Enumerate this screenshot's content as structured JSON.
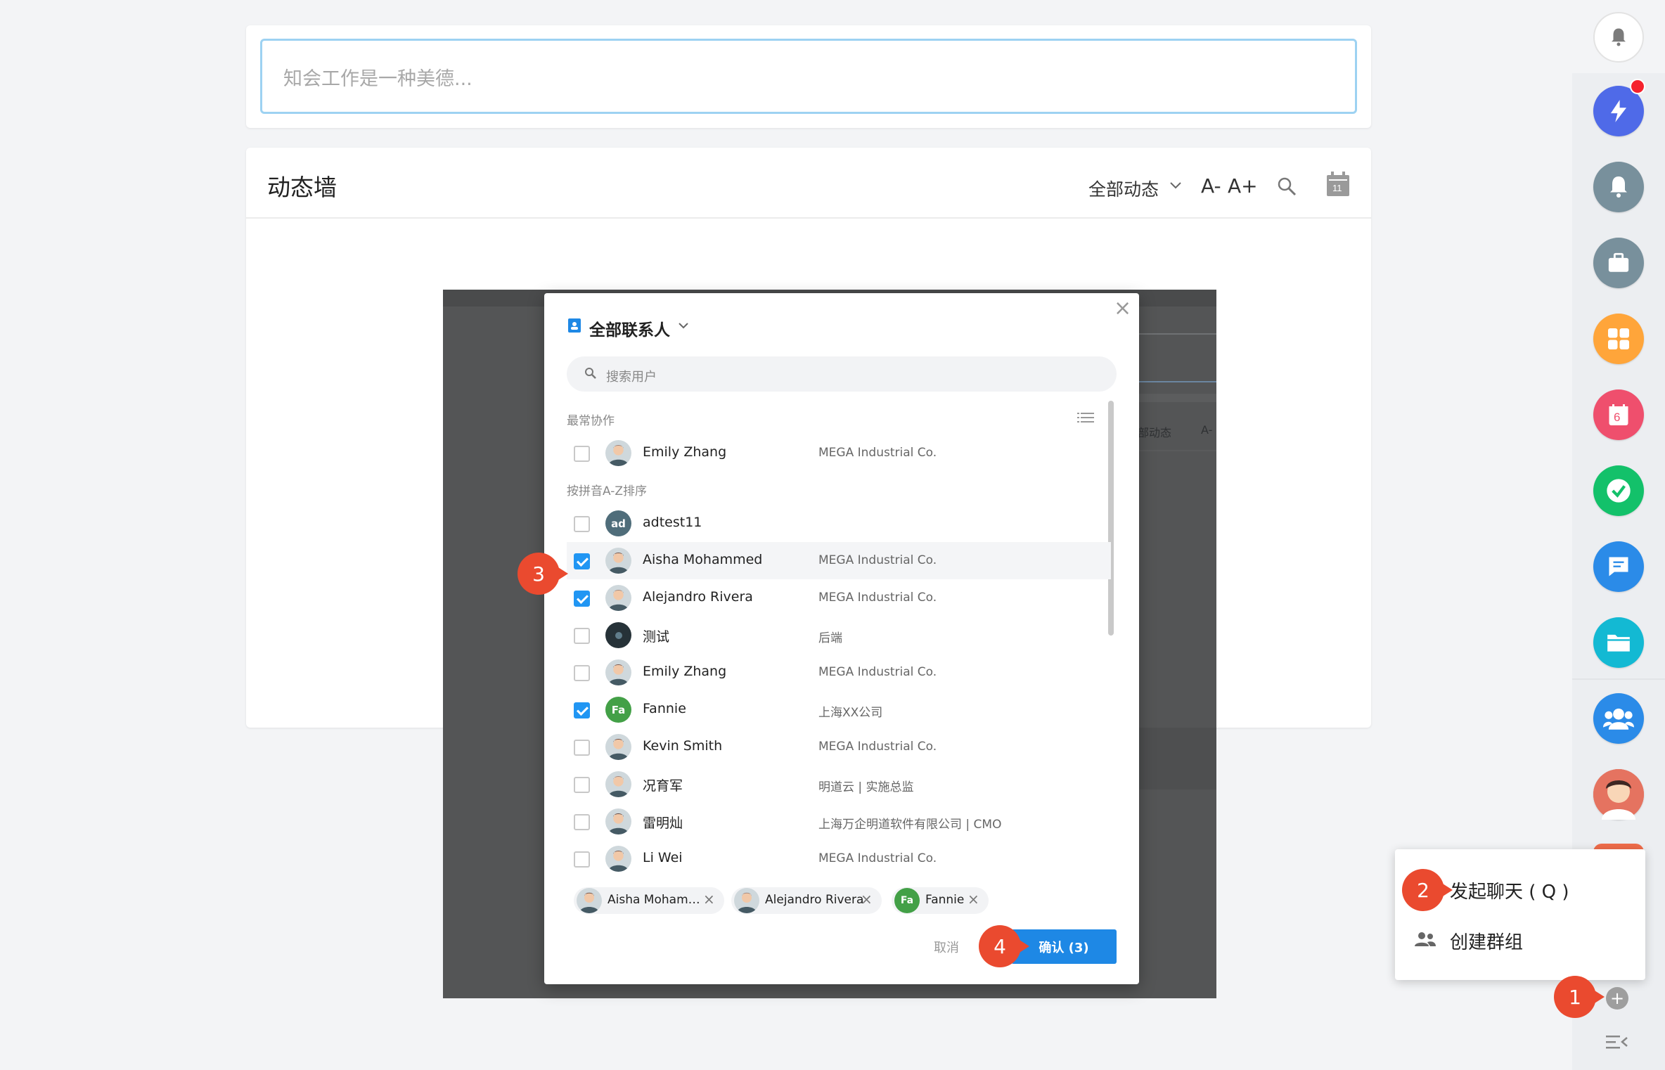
{
  "composer": {
    "placeholder": "知会工作是一种美德..."
  },
  "feed": {
    "title": "动态墙",
    "filter_label": "全部动态",
    "font_smaller": "A-",
    "font_larger": "A+",
    "calendar_day": "11"
  },
  "overlay": {
    "bg_filter_text": "部动态",
    "bg_font_text": "A-"
  },
  "dialog": {
    "title": "全部联系人",
    "search_placeholder": "搜索用户",
    "section_frequent": "最常协作",
    "section_az": "按拼音A-Z排序",
    "frequent": [
      {
        "name": "Emily Zhang",
        "org": "MEGA Industrial Co.",
        "checked": false,
        "avatar": "photo"
      }
    ],
    "contacts": [
      {
        "name": "adtest11",
        "org": "",
        "checked": false,
        "avatar": "ad",
        "avatar_color": "#4f6d7a"
      },
      {
        "name": "Aisha Mohammed",
        "org": "MEGA Industrial Co.",
        "checked": true,
        "avatar": "photo",
        "highlight": true
      },
      {
        "name": "Alejandro Rivera",
        "org": "MEGA Industrial Co.",
        "checked": true,
        "avatar": "photo"
      },
      {
        "name": "测试",
        "org": "后端",
        "checked": false,
        "avatar": "dark"
      },
      {
        "name": "Emily Zhang",
        "org": "MEGA Industrial Co.",
        "checked": false,
        "avatar": "photo"
      },
      {
        "name": "Fannie",
        "org": "上海XX公司",
        "checked": true,
        "avatar": "Fa",
        "avatar_color": "#43a047"
      },
      {
        "name": "Kevin Smith",
        "org": "MEGA Industrial Co.",
        "checked": false,
        "avatar": "photo"
      },
      {
        "name": "况育军",
        "org": "明道云 | 实施总监",
        "checked": false,
        "avatar": "photo"
      },
      {
        "name": "雷明灿",
        "org": "上海万企明道软件有限公司 | CMO",
        "checked": false,
        "avatar": "photo"
      },
      {
        "name": "Li Wei",
        "org": "MEGA Industrial Co.",
        "checked": false,
        "avatar": "photo"
      }
    ],
    "selected": [
      {
        "label": "Aisha Moham…",
        "avatar": "photo"
      },
      {
        "label": "Alejandro Rivera",
        "avatar": "photo"
      },
      {
        "label": "Fannie",
        "avatar": "Fa",
        "avatar_color": "#43a047"
      }
    ],
    "cancel_label": "取消",
    "confirm_label": "确认 (3)"
  },
  "steps": [
    "1",
    "2",
    "3",
    "4"
  ],
  "sidebar": {
    "icons": [
      {
        "name": "bell-icon",
        "color": "#ffffff"
      },
      {
        "name": "lightning-icon",
        "color": "#4f6ae8",
        "badge": true
      },
      {
        "name": "notification-bell-icon",
        "color": "#78909c"
      },
      {
        "name": "briefcase-icon",
        "color": "#78909c"
      },
      {
        "name": "apps-grid-icon",
        "color": "#ffa53a"
      },
      {
        "name": "calendar-icon",
        "color": "#ef4f6d",
        "calendar_day": "6"
      },
      {
        "name": "check-circle-icon",
        "color": "#13c16a"
      },
      {
        "name": "chat-icon",
        "color": "#2b8be8"
      },
      {
        "name": "folder-icon",
        "color": "#13b9d3"
      },
      {
        "name": "contacts-icon",
        "color": "#2b8be8"
      },
      {
        "name": "user-avatar-icon",
        "color": "#e57360"
      }
    ]
  },
  "popup_menu": {
    "items": [
      {
        "label": "发起聊天 ( Q )",
        "icon": "chat-icon"
      },
      {
        "label": "创建群组",
        "icon": "group-icon"
      }
    ]
  },
  "fab_symbol": "+"
}
